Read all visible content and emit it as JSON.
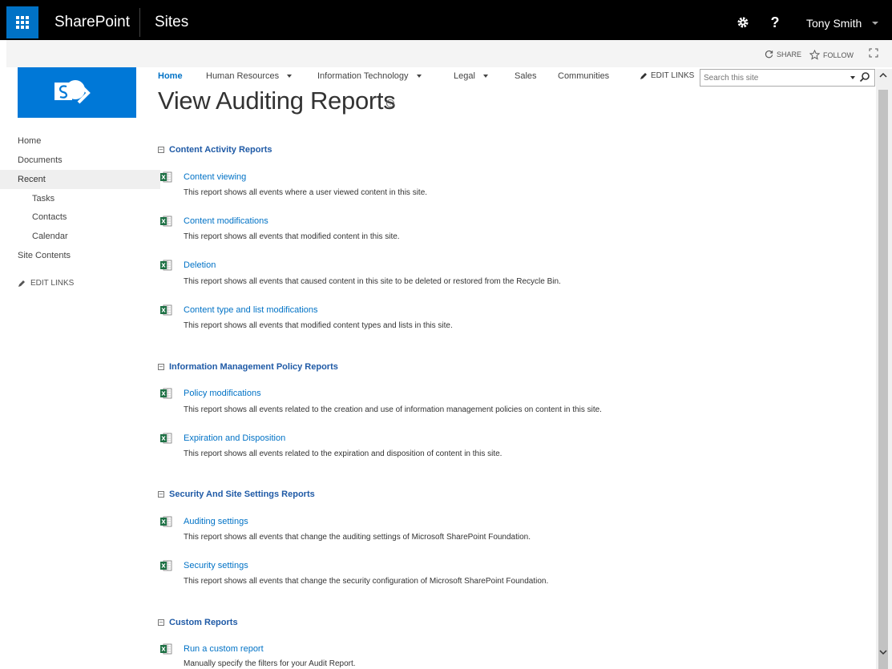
{
  "suite": {
    "brand": "SharePoint",
    "app": "Sites",
    "user": "Tony Smith",
    "help_glyph": "?"
  },
  "actions": {
    "share": "SHARE",
    "follow": "FOLLOW"
  },
  "topnav": {
    "items": [
      {
        "label": "Home"
      },
      {
        "label": "Human Resources"
      },
      {
        "label": "Information Technology"
      },
      {
        "label": "Legal"
      },
      {
        "label": "Sales"
      },
      {
        "label": "Communities"
      }
    ],
    "edit_links": "EDIT LINKS",
    "search_placeholder": "Search this site"
  },
  "leftnav": {
    "items": [
      {
        "label": "Home"
      },
      {
        "label": "Documents"
      },
      {
        "label": "Recent"
      },
      {
        "label": "Tasks"
      },
      {
        "label": "Contacts"
      },
      {
        "label": "Calendar"
      },
      {
        "label": "Site Contents"
      }
    ],
    "edit_links": "EDIT LINKS"
  },
  "page": {
    "title": "View Auditing Reports",
    "info_glyph": "i"
  },
  "sections": [
    {
      "heading": "Content Activity Reports",
      "reports": [
        {
          "title": "Content viewing",
          "desc": "This report shows all events where a user viewed content in this site."
        },
        {
          "title": "Content modifications",
          "desc": "This report shows all events that modified content in this site."
        },
        {
          "title": "Deletion",
          "desc": "This report shows all events that caused content in this site to be deleted or restored from the Recycle Bin."
        },
        {
          "title": "Content type and list modifications",
          "desc": "This report shows all events that modified content types and lists in this site."
        }
      ]
    },
    {
      "heading": "Information Management Policy Reports",
      "reports": [
        {
          "title": "Policy modifications",
          "desc": "This report shows all events related to the creation and use of information management policies on content in this site."
        },
        {
          "title": "Expiration and Disposition",
          "desc": "This report shows all events related to the expiration and disposition of content in this site."
        }
      ]
    },
    {
      "heading": "Security And Site Settings Reports",
      "reports": [
        {
          "title": "Auditing settings",
          "desc": "This report shows all events that change the auditing settings of Microsoft SharePoint Foundation."
        },
        {
          "title": "Security settings",
          "desc": "This report shows all events that change the security configuration of Microsoft SharePoint Foundation."
        }
      ]
    },
    {
      "heading": "Custom Reports",
      "reports": [
        {
          "title": "Run a custom report",
          "desc": "Manually specify the filters for your Audit Report."
        }
      ]
    }
  ],
  "icons": {
    "app_launcher": "waffle-icon",
    "settings": "gear-icon",
    "share": "sync-icon",
    "follow": "star-icon",
    "focus": "focus-mode-icon",
    "edit": "pencil-icon",
    "search": "magnifier-icon",
    "report": "excel-report-icon",
    "collapse": "collapse-minus-icon"
  },
  "colors": {
    "suite_bar": "#000000",
    "app_launcher": "#0072c6",
    "link": "#0072c6",
    "heading": "#1f5aa6",
    "logo": "#0078d7"
  }
}
